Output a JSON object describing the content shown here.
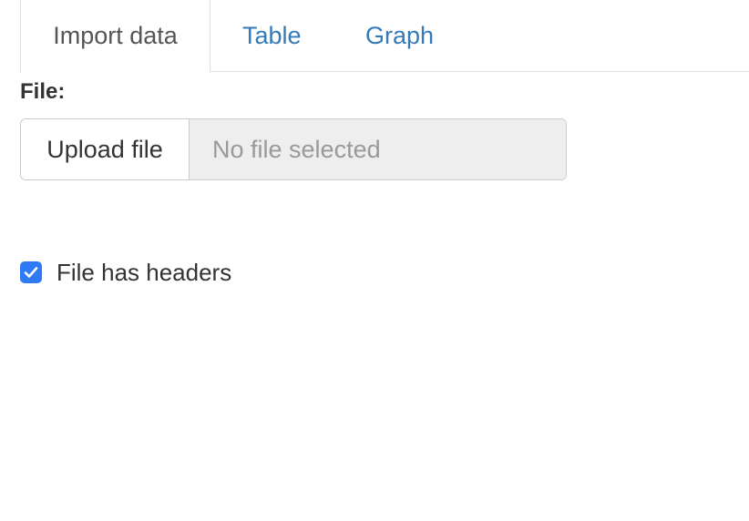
{
  "tabs": [
    {
      "label": "Import data",
      "active": true
    },
    {
      "label": "Table",
      "active": false
    },
    {
      "label": "Graph",
      "active": false
    }
  ],
  "file_input": {
    "label": "File:",
    "button_label": "Upload file",
    "status_text": "No file selected"
  },
  "headers_checkbox": {
    "label": "File has headers",
    "checked": true
  },
  "colors": {
    "link": "#337ab7",
    "checkbox_accent": "#2f7bf5",
    "field_background": "#eeeeee"
  },
  "icons": {
    "checkbox_mark": "checkmark-icon"
  }
}
